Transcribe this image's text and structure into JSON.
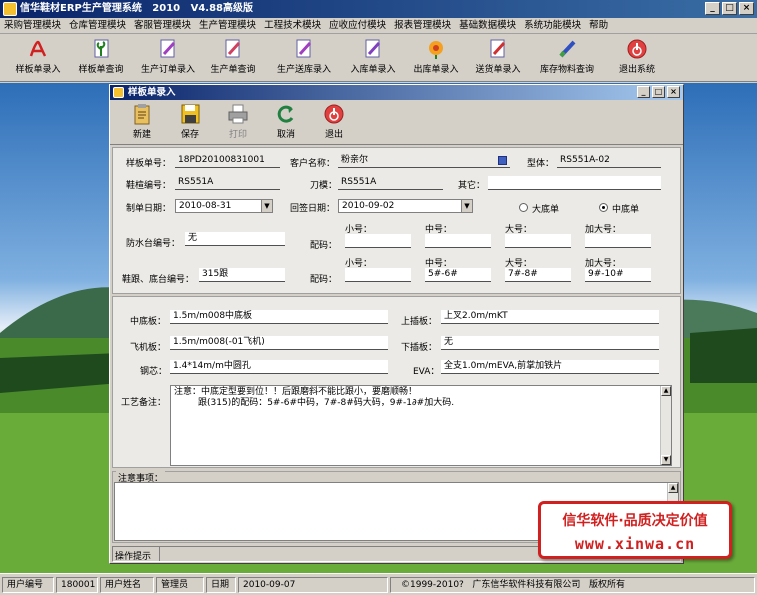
{
  "app": {
    "title": "信华鞋材ERP生产管理系统   2010   V4.88高级版"
  },
  "menu": [
    "采购管理模块",
    "仓库管理模块",
    "客服管理模块",
    "生产管理模块",
    "工程技术模块",
    "应收应付模块",
    "报表管理模块",
    "基础数据模块",
    "系统功能模块",
    "帮助"
  ],
  "toolbar": [
    "样板单录入",
    "样板单查询",
    "生产订单录入",
    "生产单查询",
    "生产送库录入",
    "入库单录入",
    "出库单录入",
    "送货单录入",
    "库存物料查询",
    "退出系统"
  ],
  "child": {
    "title": "样板单录入",
    "toolbar": [
      "新建",
      "保存",
      "打印",
      "取消",
      "退出"
    ],
    "labels": {
      "sample_no": "样板单号：",
      "customer": "客户名称：",
      "model": "型体：",
      "last_no": "鞋楦编号：",
      "knife": "刀模：",
      "other": "其它：",
      "make_date": "制单日期：",
      "return_date": "回签日期：",
      "big_sole": "大底单",
      "mid_sole": "中底单",
      "waterproof": "防水台编号：",
      "heel": "鞋跟、底台编号：",
      "size_code1": "配码：",
      "size_code2": "配码：",
      "small": "小号：",
      "medium": "中号：",
      "large": "大号：",
      "xlarge": "加大号：",
      "midsole_board": "中底板：",
      "upper_board": "上插板：",
      "fly_board": "飞机板：",
      "lower_board": "下插板：",
      "shank": "钢芯：",
      "eva": "EVA：",
      "craft_notes": "工艺备注：",
      "notes": "注意事项：",
      "tips": "操作提示"
    },
    "values": {
      "sample_no": "18PD20100831001",
      "customer": "粉亲尔",
      "model": "RS551A-02",
      "last_no": "RS551A",
      "knife": "RS551A",
      "other": "",
      "make_date": "2010-08-31",
      "return_date": "2010-09-02",
      "waterproof": "无",
      "heel": "315跟",
      "row1_small": "",
      "row1_medium": "",
      "row1_large": "",
      "row1_xlarge": "",
      "row2_small": "",
      "row2_medium": "5#-6#",
      "row2_large": "7#-8#",
      "row2_xlarge": "9#-10#",
      "midsole_board": "1.5m/m008中底板",
      "upper_board": "上叉2.0m/mKT",
      "fly_board": "1.5m/m008(-01飞机)",
      "lower_board": "无",
      "shank": "1.4*14m/m中圆孔",
      "eva": "全支1.0m/mEVA,前掌加铁片",
      "craft_line1": "注意：中底定型要到位！！后跟磨斜不能比跟小，要磨顺畅！",
      "craft_line2": "跟(315)的配码：5#-6#中码，7#-8#码大码，9#-1∂#加大码."
    },
    "selected_option": "mid_sole"
  },
  "status": {
    "user_no_label": "用户编号",
    "user_no": "180001",
    "user_name_label": "用户姓名",
    "user_name": "管理员",
    "date_label": "日期",
    "date": "2010-09-07",
    "copyright": "©1999-2010?   广东信华软件科技有限公司   版权所有"
  },
  "badge": {
    "line1": "信华软件·品质决定价值",
    "line2": "www.xinwa.cn"
  },
  "colors": {
    "title_bar": "#0a246a",
    "badge_red": "#d02020"
  }
}
